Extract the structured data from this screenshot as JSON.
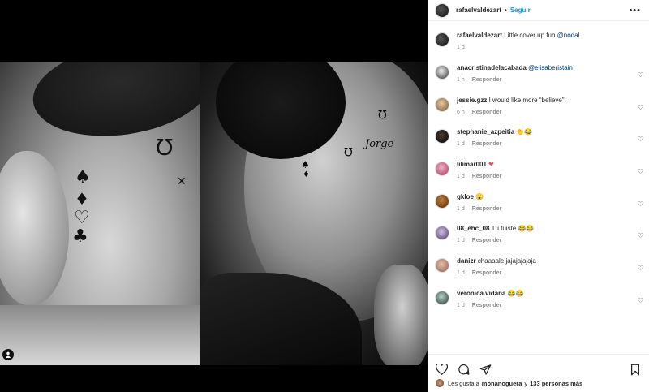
{
  "post": {
    "author": "rafaelvaldezart",
    "follow_label": "Seguir",
    "header_separator": "•",
    "more_icon": "more-horizontal-icon",
    "caption": {
      "author": "rafaelvaldezart",
      "text": "Little cover up fun",
      "mention": "@nodal",
      "time": "1 d"
    }
  },
  "photo": {
    "left_tattoos": [
      "♠",
      "♦",
      "♡",
      "♣",
      "Ω",
      "✕"
    ],
    "right_tattoos": [
      "Ω",
      "♠",
      "♦"
    ],
    "right_script": "Jorge",
    "tag_icon": "user-tag-icon"
  },
  "comments": [
    {
      "user": "anacristinadelacabada",
      "text": "",
      "mention": "@elisaberistain",
      "time": "1 h",
      "reply": "Responder"
    },
    {
      "user": "jessie.gzz",
      "text": "I would like more “believe”.",
      "mention": "",
      "time": "6 h",
      "reply": "Responder"
    },
    {
      "user": "stephanie_azpeitia",
      "text": "👏😂",
      "mention": "",
      "time": "1 d",
      "reply": "Responder"
    },
    {
      "user": "lilimar001",
      "text": "❤",
      "mention": "",
      "time": "1 d",
      "reply": "Responder"
    },
    {
      "user": "gkloe",
      "text": "😮",
      "mention": "",
      "time": "1 d",
      "reply": "Responder"
    },
    {
      "user": "08_ehc_08",
      "text": "Tú fuiste 😂😂",
      "mention": "",
      "time": "1 d",
      "reply": "Responder"
    },
    {
      "user": "danizr",
      "text": "chaaaale jajajajajaja",
      "mention": "",
      "time": "1 d",
      "reply": "Responder"
    },
    {
      "user": "veronica.vidana",
      "text": "😂😂",
      "mention": "",
      "time": "1 d",
      "reply": "Responder"
    }
  ],
  "footer": {
    "likes_prefix": "Les gusta a",
    "likes_user": "monanoguera",
    "likes_suffix": "y",
    "likes_count": "133 personas más"
  }
}
